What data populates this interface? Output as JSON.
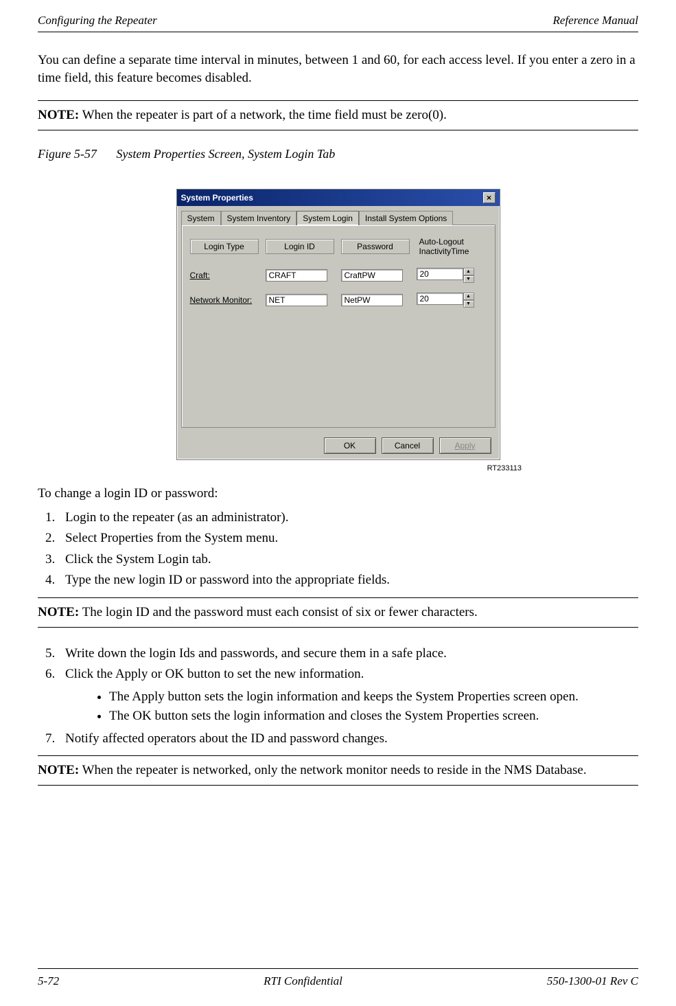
{
  "header": {
    "left": "Configuring the Repeater",
    "right": "Reference Manual"
  },
  "intro": "You can define a separate time interval in minutes, between 1 and 60, for each access level. If you enter a zero in a time field, this feature becomes disabled.",
  "note1": {
    "label": "NOTE:",
    "text": "When the repeater is part of a network, the time field must be zero(0)."
  },
  "figure": {
    "num": "Figure 5-57",
    "title": "System Properties Screen, System Login Tab"
  },
  "window": {
    "title": "System Properties",
    "close": "×",
    "tabs": [
      "System",
      "System Inventory",
      "System Login",
      "Install System Options"
    ],
    "active_tab_index": 2,
    "columns": [
      "Login Type",
      "Login ID",
      "Password",
      "Auto-Logout InactivityTime"
    ],
    "rows": [
      {
        "label": "Craft:",
        "underline_char": "C",
        "login_id": "CRAFT",
        "password": "CraftPW",
        "time": "20"
      },
      {
        "label": "Network Monitor:",
        "underline_char": "N",
        "login_id": "NET",
        "password": "NetPW",
        "time": "20"
      }
    ],
    "buttons": {
      "ok": "OK",
      "cancel": "Cancel",
      "apply": "Apply"
    }
  },
  "screenshot_id": "RT233113",
  "subheading": "To change a login ID or password:",
  "steps_a": [
    "Login to the repeater (as an administrator).",
    "Select Properties from the System menu.",
    "Click the System Login tab.",
    "Type the new login ID or password into the appropriate fields."
  ],
  "note2": {
    "label": "NOTE:",
    "text": "The login ID and the password must each consist of six or fewer characters."
  },
  "steps_b": [
    "Write down the login Ids and passwords, and secure them in a safe place.",
    "Click the Apply or OK button to set the new information."
  ],
  "substeps": [
    "The Apply button sets the login information and keeps the System Properties screen open.",
    "The OK button sets the login information and closes the System Properties screen."
  ],
  "steps_c": [
    "Notify affected operators about the ID and password changes."
  ],
  "note3": {
    "label": "NOTE:",
    "text": "When the repeater is networked, only the network monitor needs to reside in the NMS Database."
  },
  "footer": {
    "left": "5-72",
    "center": "RTI Confidential",
    "right": "550-1300-01 Rev C"
  }
}
